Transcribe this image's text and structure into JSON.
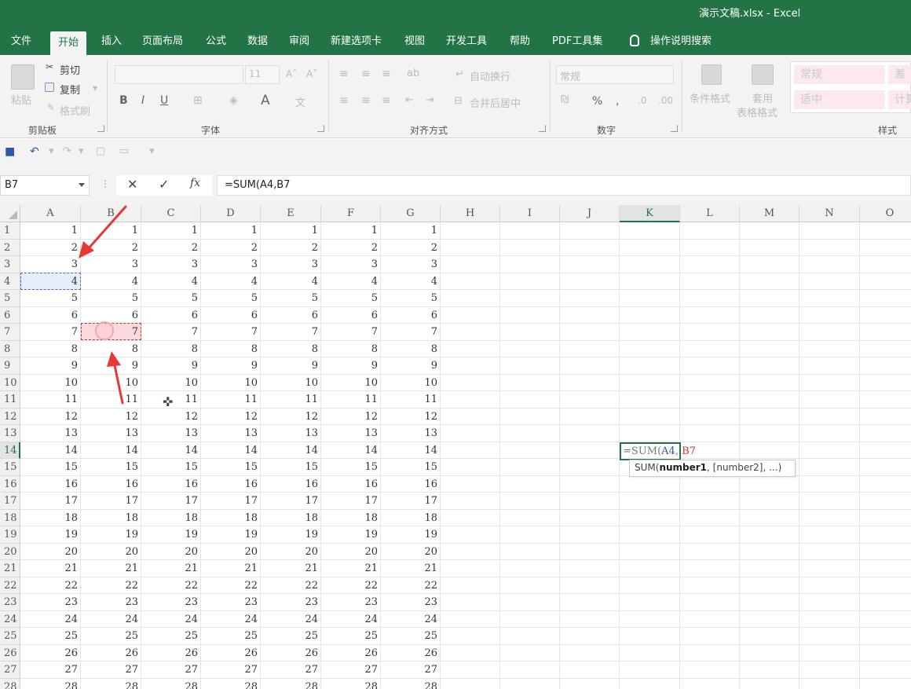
{
  "window": {
    "title": "演示文稿.xlsx  -  Excel"
  },
  "tabs": [
    "文件",
    "开始",
    "插入",
    "页面布局",
    "公式",
    "数据",
    "审阅",
    "新建选项卡",
    "视图",
    "开发工具",
    "帮助",
    "PDF工具集"
  ],
  "active_tab": "开始",
  "tell_me": "操作说明搜索",
  "ribbon": {
    "clipboard": {
      "label": "剪贴板",
      "paste": "粘贴",
      "cut": "剪切",
      "copy": "复制",
      "format_painter": "格式刷"
    },
    "font": {
      "label": "字体",
      "size": "11",
      "bold": "B",
      "italic": "I",
      "underline": "U"
    },
    "alignment": {
      "label": "对齐方式",
      "wrap": "自动换行",
      "merge": "合并后居中"
    },
    "number": {
      "label": "数字",
      "format": "常规",
      "percent": "%"
    },
    "styles": {
      "label": "样式",
      "conditional": "条件格式",
      "table_format_1": "套用",
      "table_format_2": "表格格式",
      "cells": [
        "常规",
        "差",
        "适中",
        "计算"
      ]
    }
  },
  "formula_bar": {
    "name_box": "B7",
    "cancel": "✕",
    "enter": "✓",
    "fx": "fx",
    "formula": "=SUM(A4,B7"
  },
  "columns": [
    "A",
    "B",
    "C",
    "D",
    "E",
    "F",
    "G",
    "H",
    "I",
    "J",
    "K",
    "L",
    "M",
    "N",
    "O"
  ],
  "selected_column": "K",
  "rows": [
    1,
    2,
    3,
    4,
    5,
    6,
    7,
    8,
    9,
    10,
    11,
    12,
    13,
    14,
    15,
    16,
    17,
    18,
    19,
    20,
    21,
    22,
    23,
    24,
    25,
    26,
    27,
    28
  ],
  "selected_row": 14,
  "data_columns": [
    "A",
    "B",
    "C",
    "D",
    "E",
    "F",
    "G"
  ],
  "active_cell": {
    "ref": "K14",
    "prefix": "=SUM(",
    "arg1": "A4",
    "sep": ", ",
    "arg2": "B7"
  },
  "tooltip": {
    "fn": "SUM(",
    "arg": "number1",
    "rest": ", [number2], ...)"
  },
  "colors": {
    "excel_green": "#227447",
    "ref_blue": "#2e59a6",
    "ref_red": "#c0392b",
    "arrow_red": "#e53935"
  }
}
